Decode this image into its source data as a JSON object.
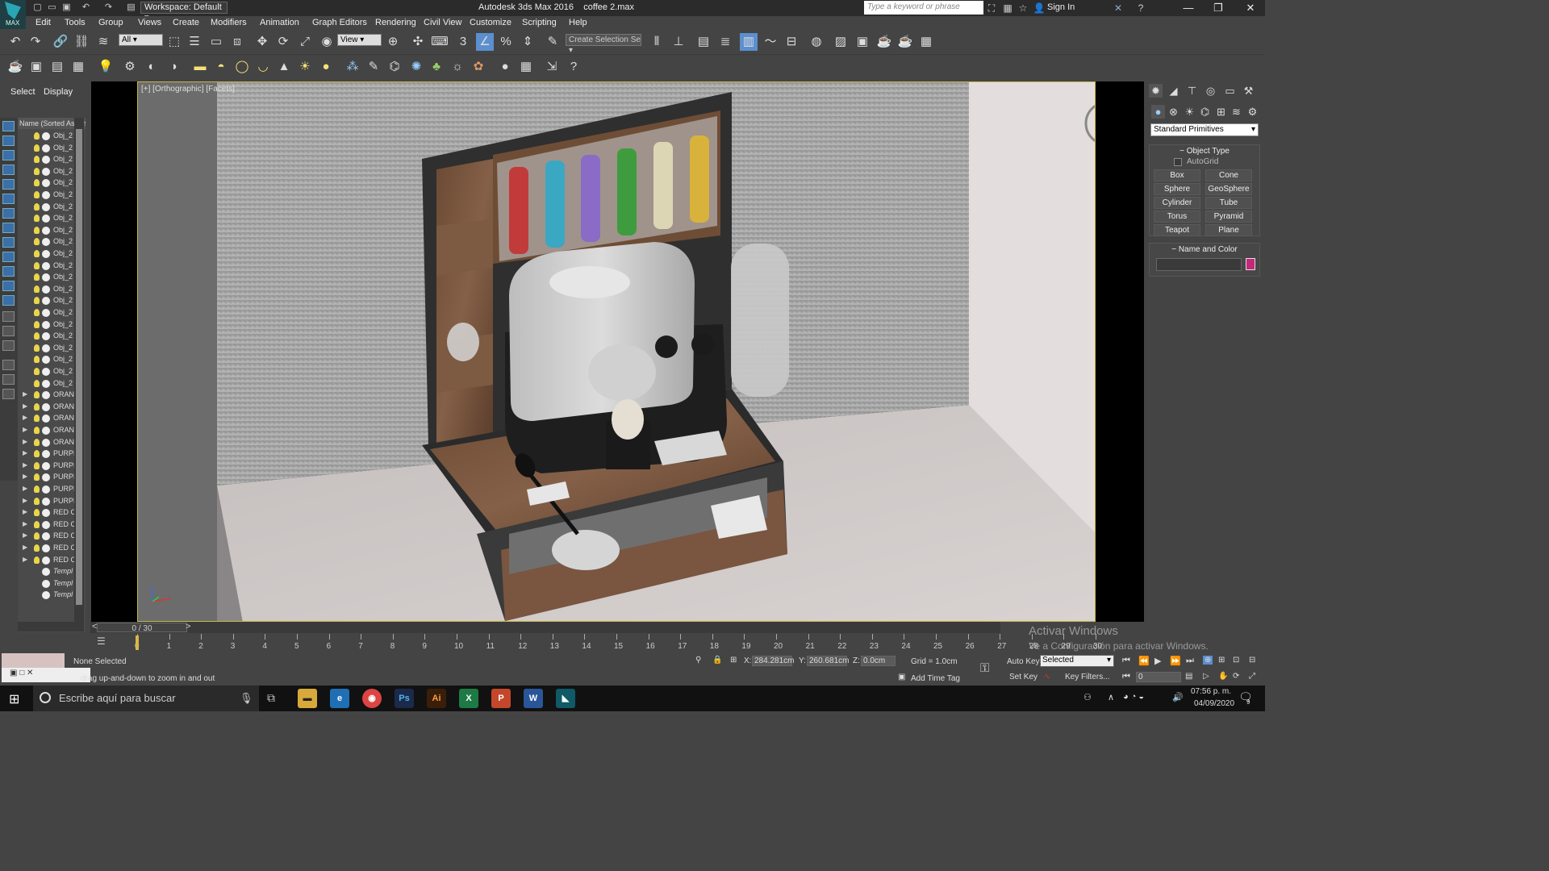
{
  "app": {
    "title": "Autodesk 3ds Max 2016",
    "file": "coffee 2.max",
    "logo_text": "MAX",
    "workspace": "Workspace: Default",
    "search_placeholder": "Type a keyword or phrase",
    "sign_in": "Sign In"
  },
  "menu": [
    "Edit",
    "Tools",
    "Group",
    "Views",
    "Create",
    "Modifiers",
    "Animation",
    "Graph Editors",
    "Rendering",
    "Civil View",
    "Customize",
    "Scripting",
    "Help"
  ],
  "toolbar": {
    "selection_filter": "All",
    "ref_coord": "View",
    "selection_set": "Create Selection Se",
    "snap_label": "3"
  },
  "scene_explorer": {
    "tabs": [
      "Select",
      "Display"
    ],
    "header": "Name (Sorted Ascending)",
    "rows": [
      {
        "name": "Obj_2",
        "type": "obj"
      },
      {
        "name": "Obj_2",
        "type": "obj"
      },
      {
        "name": "Obj_2",
        "type": "obj"
      },
      {
        "name": "Obj_2",
        "type": "obj"
      },
      {
        "name": "Obj_2",
        "type": "obj"
      },
      {
        "name": "Obj_2",
        "type": "obj"
      },
      {
        "name": "Obj_2",
        "type": "obj"
      },
      {
        "name": "Obj_2",
        "type": "obj"
      },
      {
        "name": "Obj_2",
        "type": "obj"
      },
      {
        "name": "Obj_2",
        "type": "obj"
      },
      {
        "name": "Obj_2",
        "type": "obj"
      },
      {
        "name": "Obj_2",
        "type": "obj"
      },
      {
        "name": "Obj_2",
        "type": "obj"
      },
      {
        "name": "Obj_2",
        "type": "obj"
      },
      {
        "name": "Obj_2",
        "type": "obj"
      },
      {
        "name": "Obj_2",
        "type": "obj"
      },
      {
        "name": "Obj_2",
        "type": "obj"
      },
      {
        "name": "Obj_2",
        "type": "obj"
      },
      {
        "name": "Obj_2",
        "type": "obj"
      },
      {
        "name": "Obj_2",
        "type": "obj"
      },
      {
        "name": "Obj_2",
        "type": "obj"
      },
      {
        "name": "Obj_2",
        "type": "obj"
      },
      {
        "name": "ORANG",
        "type": "grp"
      },
      {
        "name": "ORANG",
        "type": "grp"
      },
      {
        "name": "ORANG",
        "type": "grp"
      },
      {
        "name": "ORANG",
        "type": "grp"
      },
      {
        "name": "ORANG",
        "type": "grp"
      },
      {
        "name": "PURPL",
        "type": "grp"
      },
      {
        "name": "PURPL",
        "type": "grp"
      },
      {
        "name": "PURPL",
        "type": "grp"
      },
      {
        "name": "PURPL",
        "type": "grp"
      },
      {
        "name": "PURPL",
        "type": "grp"
      },
      {
        "name": "RED C",
        "type": "grp"
      },
      {
        "name": "RED C",
        "type": "grp"
      },
      {
        "name": "RED C",
        "type": "grp"
      },
      {
        "name": "RED C",
        "type": "grp"
      },
      {
        "name": "RED C",
        "type": "grp"
      },
      {
        "name": "Templ",
        "type": "tmpl"
      },
      {
        "name": "Templ",
        "type": "tmpl"
      },
      {
        "name": "Templ",
        "type": "tmpl"
      }
    ]
  },
  "viewport": {
    "label": "[+] [Orthographic] [Facets]"
  },
  "command_panel": {
    "category": "Standard Primitives",
    "object_type_title": "Object Type",
    "autogrid": "AutoGrid",
    "primitives": [
      "Box",
      "Cone",
      "Sphere",
      "GeoSphere",
      "Cylinder",
      "Tube",
      "Torus",
      "Pyramid",
      "Teapot",
      "Plane"
    ],
    "name_color_title": "Name and Color",
    "object_color": "#c4287a"
  },
  "timeline": {
    "slider": "0 / 30",
    "ticks": [
      "0",
      "1",
      "2",
      "3",
      "4",
      "5",
      "6",
      "7",
      "8",
      "9",
      "10",
      "11",
      "12",
      "13",
      "14",
      "15",
      "16",
      "17",
      "18",
      "19",
      "20",
      "21",
      "22",
      "23",
      "24",
      "25",
      "26",
      "27",
      "28",
      "29",
      "30"
    ]
  },
  "status": {
    "selection": "None Selected",
    "prompt": "drag up-and-down to zoom in and out",
    "x": "284.281cm",
    "y": "260.681cm",
    "z": "0.0cm",
    "grid": "Grid = 1.0cm",
    "auto_key": "Auto Key",
    "set_key": "Set Key",
    "key_mode": "Selected",
    "key_filters": "Key Filters...",
    "add_time_tag": "Add Time Tag",
    "frame": "0"
  },
  "watermark": {
    "line1": "Activar Windows",
    "line2": "Ve a Configuración para activar Windows."
  },
  "taskbar": {
    "search": "Escribe aquí para buscar",
    "time": "07:56 p. m.",
    "date": "04/09/2020",
    "notifications": "9"
  }
}
